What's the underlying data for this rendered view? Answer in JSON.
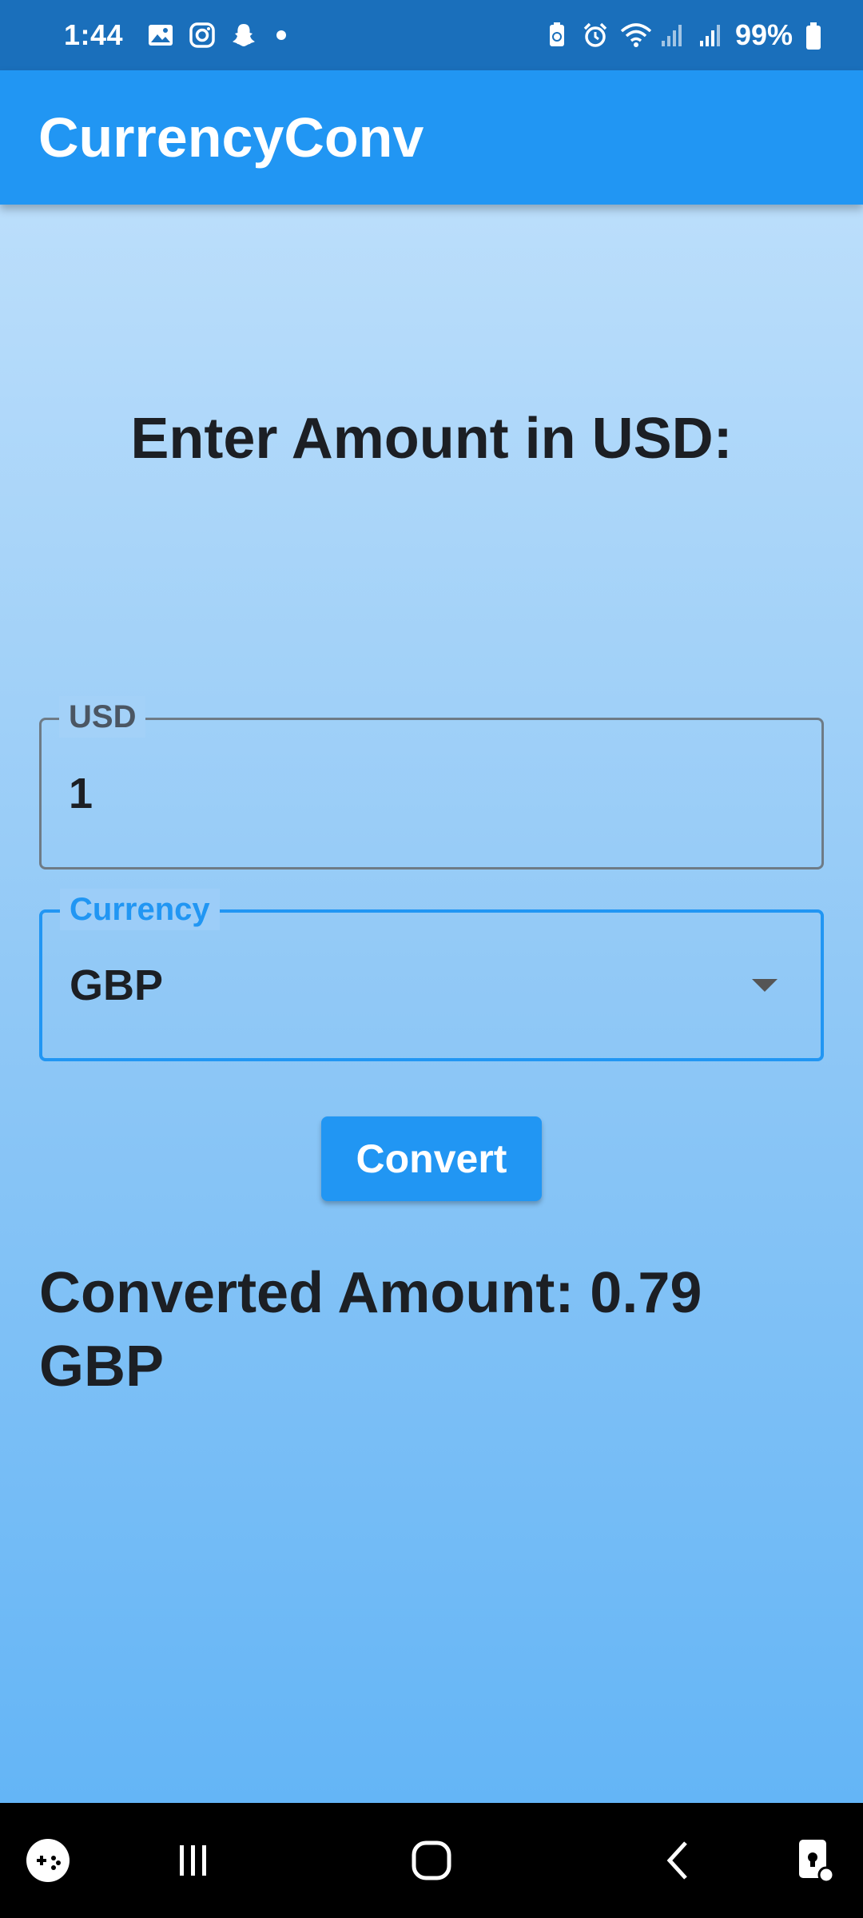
{
  "status_bar": {
    "time": "1:44",
    "battery": "99%",
    "left_icons": [
      "gallery-icon",
      "instagram-icon",
      "snapchat-icon",
      "notification-dot"
    ],
    "right_icons": [
      "battery-saver-icon",
      "alarm-icon",
      "wifi-icon",
      "signal-icon",
      "signal-icon",
      "battery-icon"
    ]
  },
  "app_bar": {
    "title": "CurrencyConv"
  },
  "main": {
    "heading": "Enter Amount in USD:",
    "amount_field": {
      "label": "USD",
      "value": "1"
    },
    "currency_field": {
      "label": "Currency",
      "selected": "GBP"
    },
    "convert_label": "Convert",
    "result_text": "Converted Amount: 0.79 GBP"
  },
  "nav_bar": {
    "items": [
      "game-launcher-icon",
      "recents-icon",
      "home-icon",
      "back-icon",
      "screen-lock-icon"
    ]
  },
  "colors": {
    "status_bar": "#1a6fbb",
    "app_bar": "#2196f3",
    "accent": "#2196f3",
    "text": "#1c1f24"
  }
}
